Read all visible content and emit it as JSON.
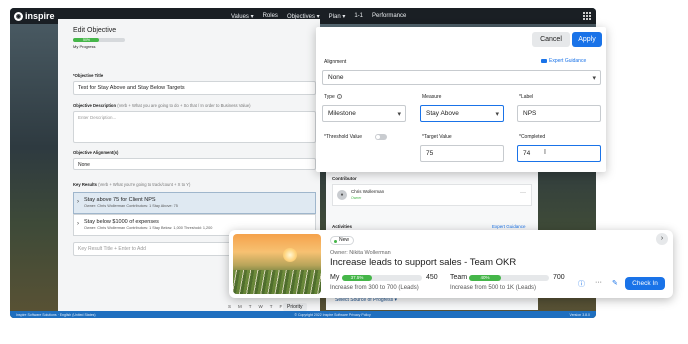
{
  "topbar": {
    "brand": "inspire",
    "nav": [
      "Values ▾",
      "Roles",
      "Objectives ▾",
      "Plan ▾",
      "1-1",
      "Performance"
    ]
  },
  "edit_panel": {
    "title": "Edit Objective",
    "progress_pct_label": "50%",
    "progress_value": 0.5,
    "progress_caption": "My Progress",
    "objective_title_label": "*Objective Title",
    "objective_title_value": "Test for Stay Above and Stay Below Targets",
    "description_label": "Objective Description",
    "description_hint": "(Verb + What you are going to do + So that / In order to Business Value)",
    "description_placeholder": "Enter Description...",
    "alignment_label": "Objective Alignment(s)",
    "alignment_value": "None",
    "key_results_label": "Key Results",
    "key_results_hint": "(Verb + What you're going to track/count + X to Y)",
    "key_results": [
      {
        "title": "Stay above 75 for Client NPS",
        "meta": "Owner: Chris Wollerman   Contributors: 1   Stay Above: 75"
      },
      {
        "title": "Stay below $1000 of expenses",
        "meta": "Owner: Chris Wollerman   Contributors: 1   Stay Below: 1,000   Threshold: 1,200"
      }
    ],
    "kr_add_placeholder": "Key Result Title + Enter to Add",
    "days": [
      "S",
      "M",
      "T",
      "W",
      "T",
      "F",
      "S"
    ],
    "priority_label": "Priority"
  },
  "side_panel": {
    "contributor_label": "Contributor",
    "contributor_name": "Chris Wollerman",
    "contributor_role": "Owner",
    "activities_label": "Activities",
    "expert_guidance": "Expert Guidance",
    "select_source": "Select Source of Progress ▾"
  },
  "popover": {
    "cancel_label": "Cancel",
    "apply_label": "Apply",
    "alignment_label": "Alignment",
    "expert_guidance": "Expert Guidance",
    "alignment_value": "None",
    "type_label": "Type",
    "type_value": "Milestone",
    "measure_label": "Measure",
    "measure_value": "Stay Above",
    "label_label": "*Label",
    "label_value": "NPS",
    "threshold_label": "*Threshold Value",
    "target_label": "*Target Value",
    "target_value": "75",
    "completed_label": "*Completed",
    "completed_value": "74"
  },
  "okr_card": {
    "badge": "New",
    "owner": "Owner: Nikita Wollerman",
    "title": "Increase leads to support sales - Team OKR",
    "my_label": "My",
    "my_pct_label": "37.5%",
    "my_progress": 0.375,
    "my_value": "450",
    "my_sub": "Increase from 300 to 700 (Leads)",
    "team_label": "Team",
    "team_pct_label": "40%",
    "team_progress": 0.4,
    "team_value": "700",
    "team_sub": "Increase from 500 to 1K (Leads)",
    "checkin_label": "Check In"
  },
  "bottombar": {
    "left": "Inspire Software Solutions  ·  English (United States)",
    "center": "© Copyright 2022 Inspire Software  Privacy Policy",
    "right": "Version 3.8.0"
  }
}
